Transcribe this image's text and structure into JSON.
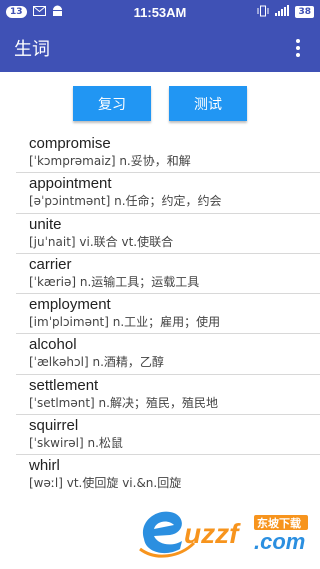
{
  "status_bar": {
    "notification_count": "13",
    "time": "11:53AM",
    "battery": "38"
  },
  "app_bar": {
    "title": "生词"
  },
  "buttons": {
    "review": "复习",
    "test": "测试"
  },
  "words": [
    {
      "word": "compromise",
      "definition": "[ˈkɔmprəmaiz] n.妥协，和解"
    },
    {
      "word": "appointment",
      "definition": "[əˈpɔintmənt] n.任命；约定，约会"
    },
    {
      "word": "unite",
      "definition": "[juˈnait] vi.联合 vt.使联合"
    },
    {
      "word": "carrier",
      "definition": "[ˈkæriə] n.运输工具；运载工具"
    },
    {
      "word": "employment",
      "definition": "[imˈplɔimənt] n.工业；雇用；使用"
    },
    {
      "word": "alcohol",
      "definition": "[ˈælkəhɔl] n.酒精，乙醇"
    },
    {
      "word": "settlement",
      "definition": "[ˈsetlmənt] n.解决；殖民，殖民地"
    },
    {
      "word": "squirrel",
      "definition": "[ˈskwirəl] n.松鼠"
    },
    {
      "word": "whirl",
      "definition": "[wəːl] vt.使回旋 vi.&n.回旋"
    }
  ],
  "watermark": {
    "brand": "uzzf",
    "domain": ".com",
    "tagline": "东坡下载"
  },
  "colors": {
    "primary": "#3F51B5",
    "button": "#2196F3",
    "watermark_orange": "#F7941D"
  }
}
